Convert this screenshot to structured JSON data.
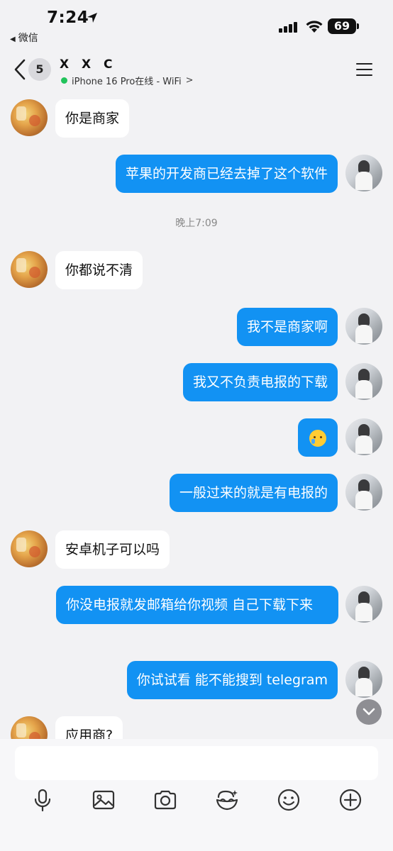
{
  "status_bar": {
    "time": "7:24",
    "back_app": "微信",
    "battery": "69"
  },
  "header": {
    "unread_count": "5",
    "contact_name": "X X C",
    "contact_status": "iPhone 16 Pro在线 - WiFi"
  },
  "messages": [
    {
      "side": "in",
      "text": "你是商家"
    },
    {
      "side": "out",
      "text": "苹果的开发商已经去掉了这个软件"
    },
    {
      "side": "divider",
      "text": "晚上7:09"
    },
    {
      "side": "in",
      "text": "你都说不清"
    },
    {
      "side": "out",
      "text": "我不是商家啊"
    },
    {
      "side": "out",
      "text": "我又不负责电报的下载"
    },
    {
      "side": "out",
      "text": "",
      "emoji": "crying-face-emoji"
    },
    {
      "side": "out",
      "text": "一般过来的就是有电报的"
    },
    {
      "side": "in",
      "text": "安卓机子可以吗"
    },
    {
      "side": "out",
      "text": "你没电报就发邮箱给你视频 自己下载下来"
    },
    {
      "side": "out",
      "text": "你试试看 能不能搜到 telegram"
    },
    {
      "side": "in",
      "text": "应用商?"
    }
  ],
  "input": {
    "value": "",
    "placeholder": ""
  },
  "toolbar": {
    "icons": [
      "microphone-icon",
      "image-icon",
      "camera-icon",
      "sticker-icon",
      "emoji-icon",
      "plus-icon"
    ]
  },
  "colors": {
    "bubble_out": "#1292f3",
    "bubble_in": "#ffffff",
    "background": "#f2f2f4",
    "online_dot": "#21c35b"
  }
}
